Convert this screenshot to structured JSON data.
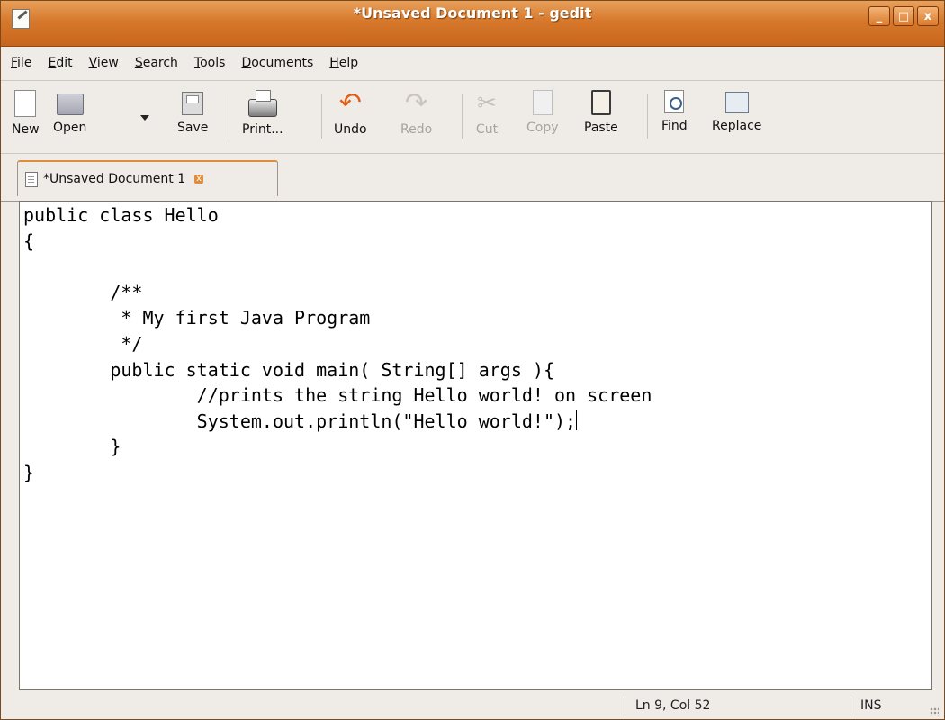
{
  "window": {
    "title": "*Unsaved Document 1 - gedit",
    "controls": {
      "minimize": "_",
      "maximize": "□",
      "close": "x"
    }
  },
  "menu": {
    "items": [
      {
        "mnemonic": "F",
        "rest": "ile"
      },
      {
        "mnemonic": "E",
        "rest": "dit"
      },
      {
        "mnemonic": "V",
        "rest": "iew"
      },
      {
        "mnemonic": "S",
        "rest": "earch"
      },
      {
        "mnemonic": "T",
        "rest": "ools"
      },
      {
        "mnemonic": "D",
        "rest": "ocuments"
      },
      {
        "mnemonic": "H",
        "rest": "elp"
      }
    ]
  },
  "toolbar": {
    "new": "New",
    "open": "Open",
    "save": "Save",
    "print": "Print...",
    "undo": "Undo",
    "redo": "Redo",
    "cut": "Cut",
    "copy": "Copy",
    "paste": "Paste",
    "find": "Find",
    "replace": "Replace"
  },
  "tab": {
    "label": "*Unsaved Document 1",
    "close": "x"
  },
  "editor": {
    "lines": [
      "public class Hello",
      "{",
      "",
      "        /**",
      "         * My first Java Program",
      "         */",
      "        public static void main( String[] args ){",
      "                //prints the string Hello world! on screen",
      "                System.out.println(\"Hello world!\");",
      "        }",
      "}"
    ],
    "caret_line": 9,
    "caret_col": 52
  },
  "status": {
    "position": "Ln 9, Col 52",
    "mode": "INS"
  },
  "colors": {
    "titlebar": "#d6782c",
    "accent": "#e08c3c",
    "undo_icon": "#e0601a"
  }
}
